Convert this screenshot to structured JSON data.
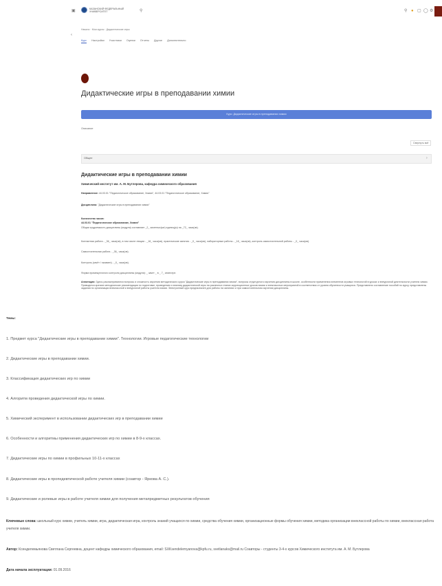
{
  "header": {
    "university": "КАЗАНСКИЙ ФЕДЕРАЛЬНЫЙ УНИВЕРСИТЕТ",
    "icons": [
      "sidebar-toggle-icon",
      "logo-icon",
      "search-icon",
      "bell-icon",
      "chat-icon",
      "user-menu-icon"
    ]
  },
  "breadcrumb": "Начало · Мои курсы · Дидактические игры",
  "tabs": [
    "Курс",
    "Настройки",
    "Участники",
    "Оценки",
    "Отчеты",
    "Другое",
    "Дополнительно"
  ],
  "course": {
    "title": "Дидактические игры в преподавании химии",
    "button_label": "Курс: Дидактические игры в преподавании химии",
    "progress_label": "Описание",
    "collapse_label": "Свернуть всё",
    "section_name": "Общее"
  },
  "section": {
    "title": "Дидактические игры в преподавании химии",
    "institute": "Химический институт им. А. М. Бутлерова, кафедра химического образования",
    "direction_label": "Направление:",
    "direction_text": "44.03.01 \"Педагогическое образование, Химия\", 44.03.01 \"Педагогическое образование, Химия\"",
    "discipline_label": "Дисциплина:",
    "discipline_text": "\"Дидактические игры в преподавании химии\"",
    "hours_heading": "Количество часов:",
    "hours_sub": "44.03.01 \"Педагогическое образование, Химия\"",
    "hours": [
      "Общая трудоемкость дисциплины (модуля) составляет _2_ зачетных(ые) единиц(ы) на _72_ часа(ов).",
      "Контактная работа - _36_ часа(ов), в том числе лекции - _18_ часа(ов), практические занятия - _0_ часа(ов), лабораторные работы - _18_ часа(ов), контроль самостоятельной работы - _0_ часа(ов).",
      "Самостоятельная работа - _36_ часа(ов).",
      "Контроль (зачёт / экзамен) - _0_ часа(ов).",
      "Форма промежуточного контроля дисциплины (модуля): _ зачет _ в _ 7_ семестре."
    ],
    "annotation_label": "Аннотация:",
    "annotation_text": "Здесь рассматриваются вопросы и сложность изучения методического курса \"Дидактические игры в преподавании химии\", вопросы структурного изучения дисциплины в школе, особенности применения элементов игровых технологий в уроках и внеурочной деятельности учителя химии. Приводятся краткие методические рекомендации по подготовке, проведению и анализу дидактической игры на различных этапах коррекционных уроков химии и внеклассных мероприятий в соответствии от уровня обученности учащихся. Представлено составление пособий по курсу, представлены задания по организации внеклассной и внеурочной работы учителя химии. Электронный курс предназначен для работы на занятиях и при самостоятельном изучении дисциплины."
  },
  "themes": {
    "heading": "Темы:",
    "items": [
      "1. Предмет курса \"Дидактические игры в преподавании химии\". Технологии. Игровые педагогические технологии",
      "2. Дидактические игры в преподавании химии.",
      "3. Классификация дидактических игр по химии",
      "4. Алгоритм проведения дидактической игры по химии.",
      "5. Химический эксперимент в использовании дидактических игр в преподавании химии",
      "6. Особенности и алгоритмы применения дидактических игр по химии в 8-9-х классах.",
      "7. Дидактические игры по химии в профильных 10-11-х классах",
      "8. Дидактические игры в пропедевтической работе учителя химии (соавтор - Яркова А. С.).",
      "9. Дидактические и ролевые игры в работе учителя химии для получения метапредметных результатов обучения"
    ]
  },
  "keywords": {
    "label": "Ключевые слова:",
    "text": "школьный курс химии, учитель химии, игра, дидактическая игра, контроль знаний учащихся по химии, средства обучения химии, организационные формы обучения химии, методика организации внеклассной работы по химии, внеклассная работа учителя химии."
  },
  "author": {
    "label": "Автор:",
    "text": "Ксенделемьянова Светлана Сергеевна, доцент кафедры химического образования, email: SXKsendelemyanova@kpfu.ru, svetlanaks@mail.ru Соавторы - студенты 3-4-х курсов Химического института им. А. М. Бутлерова"
  },
  "start_date": {
    "label": "Дата начала эксплуатации:",
    "value": "01.09.2016"
  }
}
